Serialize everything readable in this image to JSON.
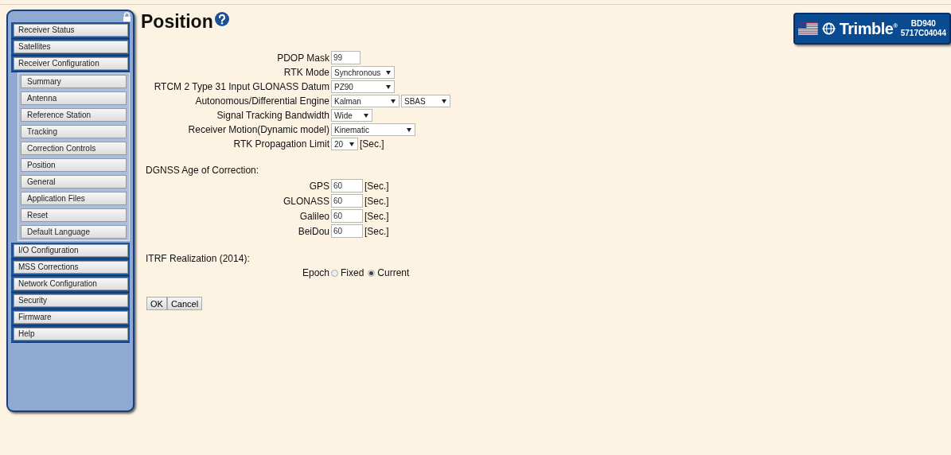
{
  "sidebar": {
    "items": [
      {
        "label": "Receiver Status"
      },
      {
        "label": "Satellites"
      },
      {
        "label": "Receiver Configuration",
        "children": [
          {
            "label": "Summary"
          },
          {
            "label": "Antenna"
          },
          {
            "label": "Reference Station"
          },
          {
            "label": "Tracking"
          },
          {
            "label": "Correction Controls"
          },
          {
            "label": "Position"
          },
          {
            "label": "General"
          },
          {
            "label": "Application Files"
          },
          {
            "label": "Reset"
          },
          {
            "label": "Default Language"
          }
        ]
      },
      {
        "label": "I/O Configuration"
      },
      {
        "label": "MSS Corrections"
      },
      {
        "label": "Network Configuration"
      },
      {
        "label": "Security"
      },
      {
        "label": "Firmware"
      },
      {
        "label": "Help"
      }
    ]
  },
  "page": {
    "title": "Position"
  },
  "badge": {
    "logo": "Trimble$^{®}$",
    "model": "BD940",
    "serial": "5717C04044"
  },
  "settings": [
    {
      "kind": "input",
      "label": "PDOP Mask",
      "value": "99"
    },
    {
      "kind": "select",
      "label": "RTK Mode",
      "value": "Synchronous"
    },
    {
      "kind": "select",
      "label": "RTCM 2 Type 31 Input GLONASS Datum",
      "value": "PZ90"
    },
    {
      "kind": "select_pair",
      "label": "Autonomous/Differential Engine",
      "value": "Kalman",
      "value2": "SBAS"
    },
    {
      "kind": "select",
      "label": "Signal Tracking Bandwidth",
      "value": "Wide"
    },
    {
      "kind": "select",
      "label": "Receiver Motion(Dynamic model)",
      "value": "Kinematic"
    },
    {
      "kind": "select",
      "label": "RTK Propagation Limit",
      "value": "20",
      "unit": "[Sec.]"
    }
  ],
  "dgnss": {
    "heading": "DGNSS Age of Correction:",
    "rows": [
      {
        "label": "GPS",
        "value": "60",
        "unit": "[Sec.]"
      },
      {
        "label": "GLONASS",
        "value": "60",
        "unit": "[Sec.]"
      },
      {
        "label": "Galileo",
        "value": "60",
        "unit": "[Sec.]"
      },
      {
        "label": "BeiDou",
        "value": "60",
        "unit": "[Sec.]"
      }
    ]
  },
  "itrf": {
    "heading": "ITRF Realization (2014):",
    "label": "Epoch",
    "options": [
      {
        "label": "Fixed",
        "selected": false
      },
      {
        "label": "Current",
        "selected": true
      }
    ]
  },
  "buttons": [
    "OK",
    "Cancel"
  ]
}
